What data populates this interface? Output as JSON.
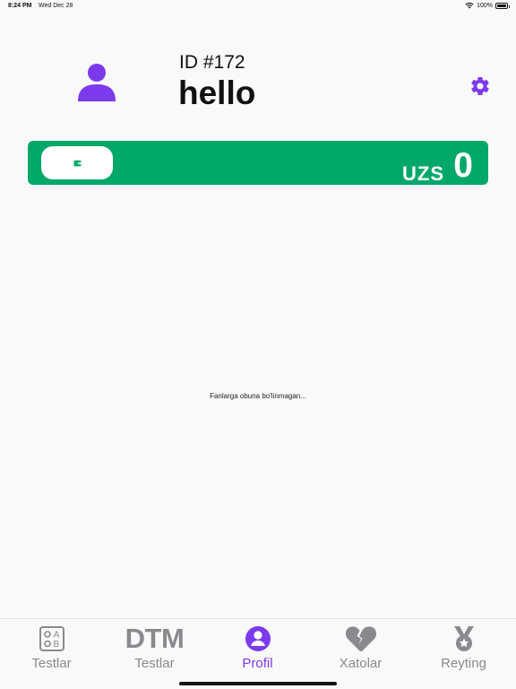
{
  "status_bar": {
    "time": "8:24 PM",
    "date": "Wed Dec 28",
    "battery": "100%"
  },
  "profile": {
    "id_label": "ID #172",
    "name": "hello",
    "avatar_icon": "user-icon",
    "settings_icon": "gear-icon"
  },
  "balance": {
    "currency": "UZS",
    "amount": "0",
    "wallet_icon": "wallet-icon"
  },
  "subscriptions": {
    "empty_message": "Fanlarga obuna bo'linmagan..."
  },
  "tabs": [
    {
      "label": "Testlar",
      "icon": "test-options-icon",
      "active": false
    },
    {
      "label": "Testlar",
      "icon_text": "DTM",
      "icon": "dtm-logo-icon",
      "active": false
    },
    {
      "label": "Profil",
      "icon": "profile-icon",
      "active": true
    },
    {
      "label": "Xatolar",
      "icon": "broken-heart-icon",
      "active": false
    },
    {
      "label": "Reyting",
      "icon": "medal-icon",
      "active": false
    }
  ],
  "colors": {
    "accent": "#7c3aed",
    "balance_card": "#02a869",
    "inactive_tab": "#8a8a8e",
    "background": "#f9f9f9"
  }
}
